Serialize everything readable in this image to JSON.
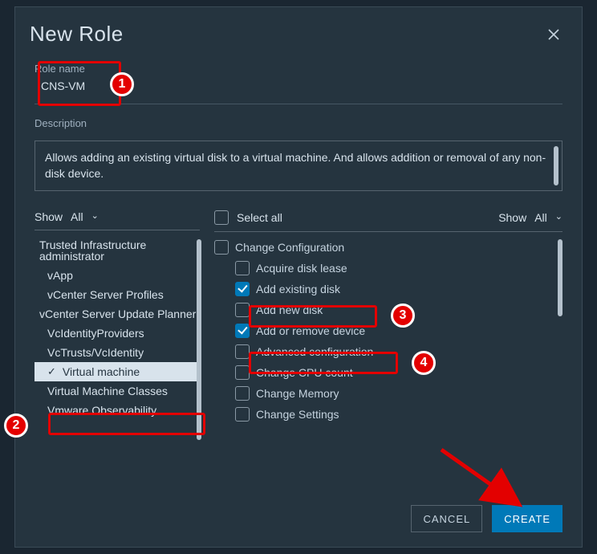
{
  "dialog": {
    "title": "New Role"
  },
  "role": {
    "label": "Role name",
    "value": "CNS-VM"
  },
  "description": {
    "label": "Description",
    "text": "Allows adding an existing virtual disk to a virtual machine. And allows addition or removal of any non-disk device."
  },
  "left_pane": {
    "show_label": "Show",
    "show_value": "All",
    "items": [
      {
        "label": "Trusted Infrastructure administrator",
        "indent": 1,
        "selected": false
      },
      {
        "label": "vApp",
        "indent": 2,
        "selected": false
      },
      {
        "label": "vCenter Server Profiles",
        "indent": 2,
        "selected": false
      },
      {
        "label": "vCenter Server Update Planner",
        "indent": 1,
        "selected": false
      },
      {
        "label": "VcIdentityProviders",
        "indent": 2,
        "selected": false
      },
      {
        "label": "VcTrusts/VcIdentity",
        "indent": 2,
        "selected": false
      },
      {
        "label": "Virtual machine",
        "indent": 2,
        "selected": true
      },
      {
        "label": "Virtual Machine Classes",
        "indent": 2,
        "selected": false
      },
      {
        "label": "Vmware Observability",
        "indent": 2,
        "selected": false
      }
    ]
  },
  "right_pane": {
    "select_all": "Select all",
    "show_label": "Show",
    "show_value": "All",
    "group": "Change Configuration",
    "items": [
      {
        "label": "Acquire disk lease",
        "checked": false
      },
      {
        "label": "Add existing disk",
        "checked": true
      },
      {
        "label": "Add new disk",
        "checked": false
      },
      {
        "label": "Add or remove device",
        "checked": true
      },
      {
        "label": "Advanced configuration",
        "checked": false
      },
      {
        "label": "Change CPU count",
        "checked": false
      },
      {
        "label": "Change Memory",
        "checked": false
      },
      {
        "label": "Change Settings",
        "checked": false
      }
    ]
  },
  "footer": {
    "cancel": "CANCEL",
    "create": "CREATE"
  },
  "annotations": {
    "b1": "1",
    "b2": "2",
    "b3": "3",
    "b4": "4"
  }
}
